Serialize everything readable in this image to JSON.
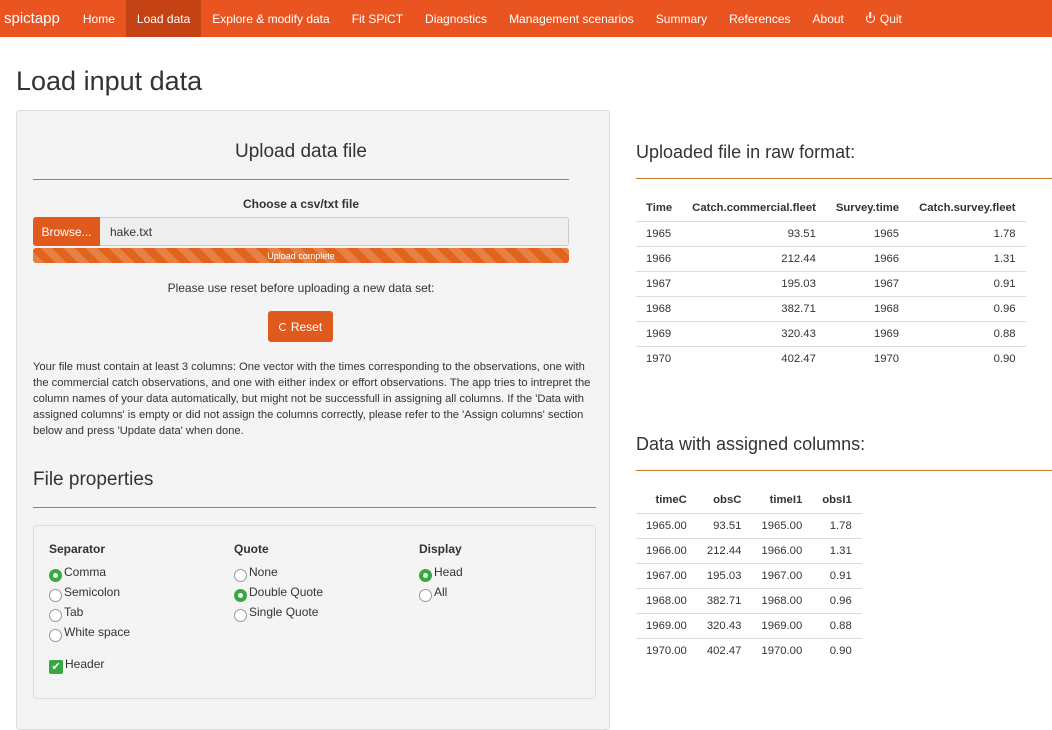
{
  "navbar": {
    "brand": "spictapp",
    "items": [
      {
        "label": "Home"
      },
      {
        "label": "Load data",
        "active": true
      },
      {
        "label": "Explore & modify data"
      },
      {
        "label": "Fit SPiCT"
      },
      {
        "label": "Diagnostics"
      },
      {
        "label": "Management scenarios"
      },
      {
        "label": "Summary"
      },
      {
        "label": "References"
      },
      {
        "label": "About"
      }
    ],
    "quit": "Quit",
    "quit_icon": "power-icon",
    "color": "#e95420"
  },
  "page": {
    "title": "Load input data"
  },
  "upload": {
    "title": "Upload data file",
    "file_label": "Choose a csv/txt file",
    "browse_label": "Browse...",
    "file_name": "hake.txt",
    "progress_text": "Upload complete",
    "progress": 1.0,
    "reset_note": "Please use reset before uploading a new data set:",
    "reset_label": "Reset",
    "reset_icon": "refresh-icon",
    "info": "Your file must contain at least 3 columns: One vector with the times corresponding to the observations, one with the commercial catch observations, and one with either index or effort observations. The app tries to intrepret the column names of your data automatically, but might not be successfull in assigning all columns. If the 'Data with assigned columns' is empty or did not assign the columns correctly, please refer to the 'Assign columns' section below and press 'Update data' when done."
  },
  "file_properties": {
    "title": "File properties",
    "separator": {
      "label": "Separator",
      "options": [
        {
          "label": "Comma",
          "checked": true
        },
        {
          "label": "Semicolon",
          "checked": false
        },
        {
          "label": "Tab",
          "checked": false
        },
        {
          "label": "White space",
          "checked": false
        }
      ]
    },
    "quote": {
      "label": "Quote",
      "options": [
        {
          "label": "None",
          "checked": false
        },
        {
          "label": "Double Quote",
          "checked": true
        },
        {
          "label": "Single Quote",
          "checked": false
        }
      ]
    },
    "display": {
      "label": "Display",
      "options": [
        {
          "label": "Head",
          "checked": true
        },
        {
          "label": "All",
          "checked": false
        }
      ]
    },
    "header": {
      "label": "Header",
      "checked": true
    }
  },
  "raw_table": {
    "title": "Uploaded file in raw format:",
    "columns": [
      "Time",
      "Catch.commercial.fleet",
      "Survey.time",
      "Catch.survey.fleet"
    ],
    "rows": [
      [
        "1965",
        "93.51",
        "1965",
        "1.78"
      ],
      [
        "1966",
        "212.44",
        "1966",
        "1.31"
      ],
      [
        "1967",
        "195.03",
        "1967",
        "0.91"
      ],
      [
        "1968",
        "382.71",
        "1968",
        "0.96"
      ],
      [
        "1969",
        "320.43",
        "1969",
        "0.88"
      ],
      [
        "1970",
        "402.47",
        "1970",
        "0.90"
      ]
    ]
  },
  "assigned_table": {
    "title": "Data with assigned columns:",
    "columns": [
      "timeC",
      "obsC",
      "timeI1",
      "obsI1"
    ],
    "rows": [
      [
        "1965.00",
        "93.51",
        "1965.00",
        "1.78"
      ],
      [
        "1966.00",
        "212.44",
        "1966.00",
        "1.31"
      ],
      [
        "1967.00",
        "195.03",
        "1967.00",
        "0.91"
      ],
      [
        "1968.00",
        "382.71",
        "1968.00",
        "0.96"
      ],
      [
        "1969.00",
        "320.43",
        "1969.00",
        "0.88"
      ],
      [
        "1970.00",
        "402.47",
        "1970.00",
        "0.90"
      ]
    ]
  },
  "colors": {
    "accent": "#e05a1d",
    "radio_checked": "#38a843",
    "rule": "#c0792e"
  }
}
